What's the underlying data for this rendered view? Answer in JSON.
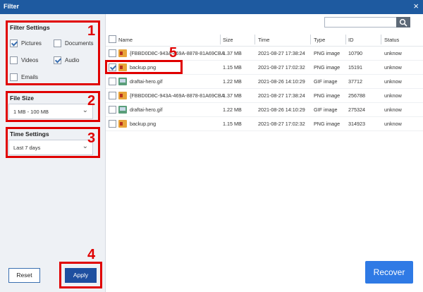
{
  "window": {
    "title": "Filter",
    "close_glyph": "×"
  },
  "filter_settings": {
    "title": "Filter Settings",
    "options": [
      {
        "label": "Pictures",
        "checked": true
      },
      {
        "label": "Documents",
        "checked": false
      },
      {
        "label": "Videos",
        "checked": false
      },
      {
        "label": "Audio",
        "checked": true
      },
      {
        "label": "Emails",
        "checked": false
      }
    ]
  },
  "file_size": {
    "title": "File Size",
    "value": "1 MB - 100 MB"
  },
  "time_settings": {
    "title": "Time Settings",
    "value": "Last 7 days"
  },
  "buttons": {
    "reset": "Reset",
    "apply": "Apply",
    "recover": "Recover"
  },
  "annotations": [
    "1",
    "2",
    "3",
    "4",
    "5"
  ],
  "annotation_color": "#e00000",
  "search": {
    "placeholder": "",
    "value": ""
  },
  "table": {
    "columns": [
      "Name",
      "Size",
      "Time",
      "Type",
      "ID",
      "Status"
    ],
    "rows": [
      {
        "name": "{FBBD0D8C-943A-469A-8878-81A69CBA",
        "size": "1.37 MB",
        "time": "2021-08-27 17:38:24",
        "type": "PNG image",
        "id": "10790",
        "status": "unknow",
        "icon": "png",
        "checked": false
      },
      {
        "name": "backup.png",
        "size": "1.15 MB",
        "time": "2021-08-27 17:02:32",
        "type": "PNG image",
        "id": "15191",
        "status": "unknow",
        "icon": "png",
        "checked": true
      },
      {
        "name": "draftai-hero.gif",
        "size": "1.22 MB",
        "time": "2021-08-26 14:10:29",
        "type": "GIF image",
        "id": "37712",
        "status": "unknow",
        "icon": "gif",
        "checked": false
      },
      {
        "name": "{FBBD0D8C-943A-469A-8878-81A69CBA",
        "size": "1.37 MB",
        "time": "2021-08-27 17:38:24",
        "type": "PNG image",
        "id": "256788",
        "status": "unknow",
        "icon": "png",
        "checked": false
      },
      {
        "name": "draftai-hero.gif",
        "size": "1.22 MB",
        "time": "2021-08-26 14:10:29",
        "type": "GIF image",
        "id": "275324",
        "status": "unknow",
        "icon": "gif",
        "checked": false
      },
      {
        "name": "backup.png",
        "size": "1.15 MB",
        "time": "2021-08-27 17:02:32",
        "type": "PNG image",
        "id": "314923",
        "status": "unknow",
        "icon": "png",
        "checked": false
      }
    ]
  },
  "colors": {
    "titlebar": "#1e5aa0",
    "apply": "#1e4fa0",
    "recover": "#2f7ae5",
    "sidebar": "#eef1f5"
  }
}
